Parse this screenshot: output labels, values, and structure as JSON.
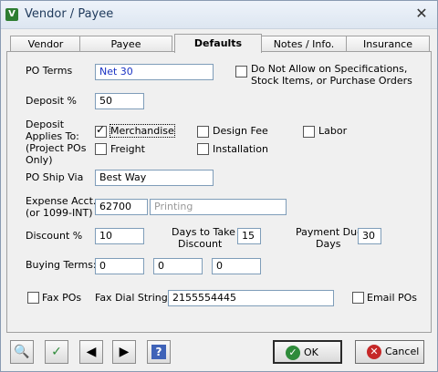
{
  "window": {
    "title": "Vendor / Payee"
  },
  "tabs": [
    {
      "label": "Vendor"
    },
    {
      "label": "Payee"
    },
    {
      "label": "Defaults"
    },
    {
      "label": "Notes / Info."
    },
    {
      "label": "Insurance"
    }
  ],
  "form": {
    "po_terms": {
      "label": "PO Terms",
      "value": "Net 30"
    },
    "no_allow": {
      "label_line1": "Do Not Allow on Specifications,",
      "label_line2": "Stock Items, or Purchase Orders",
      "checked": false
    },
    "deposit_pct": {
      "label": "Deposit %",
      "value": "50"
    },
    "deposit_applies": {
      "label_lines": [
        "Deposit",
        "Applies To:",
        "(Project POs",
        "Only)"
      ],
      "options": [
        {
          "label": "Merchandise",
          "checked": true
        },
        {
          "label": "Design Fee",
          "checked": false
        },
        {
          "label": "Labor",
          "checked": false
        },
        {
          "label": "Freight",
          "checked": false
        },
        {
          "label": "Installation",
          "checked": false
        }
      ]
    },
    "po_ship_via": {
      "label": "PO Ship Via",
      "value": "Best Way"
    },
    "expense_acct": {
      "label_line1": "Expense Acct.",
      "label_line2": "(or 1099-INT)",
      "value": "62700",
      "description": "Printing"
    },
    "discount_pct": {
      "label": "Discount %",
      "value": "10"
    },
    "days_to_take": {
      "label_line1": "Days to Take",
      "label_line2": "Discount",
      "value": "15"
    },
    "payment_due": {
      "label_line1": "Payment Due",
      "label_line2": "Days",
      "value": "30"
    },
    "buying_terms": {
      "label": "Buying Terms:",
      "values": [
        "0",
        "0",
        "0"
      ]
    },
    "fax_pos": {
      "label": "Fax POs",
      "checked": false
    },
    "fax_dial": {
      "label": "Fax Dial String",
      "value": "2155554445"
    },
    "email_pos": {
      "label": "Email POs",
      "checked": false
    }
  },
  "buttons": {
    "ok": "OK",
    "cancel": "Cancel"
  },
  "icons": {
    "search": "search-icon",
    "spellcheck": "spellcheck-icon",
    "prev": "previous-icon",
    "next": "next-icon",
    "help": "help-icon"
  },
  "colors": {
    "title_text": "#1e395b",
    "field_blue_text": "#1a33c4",
    "ok_green": "#2e8b3a",
    "cancel_red": "#c62828"
  }
}
